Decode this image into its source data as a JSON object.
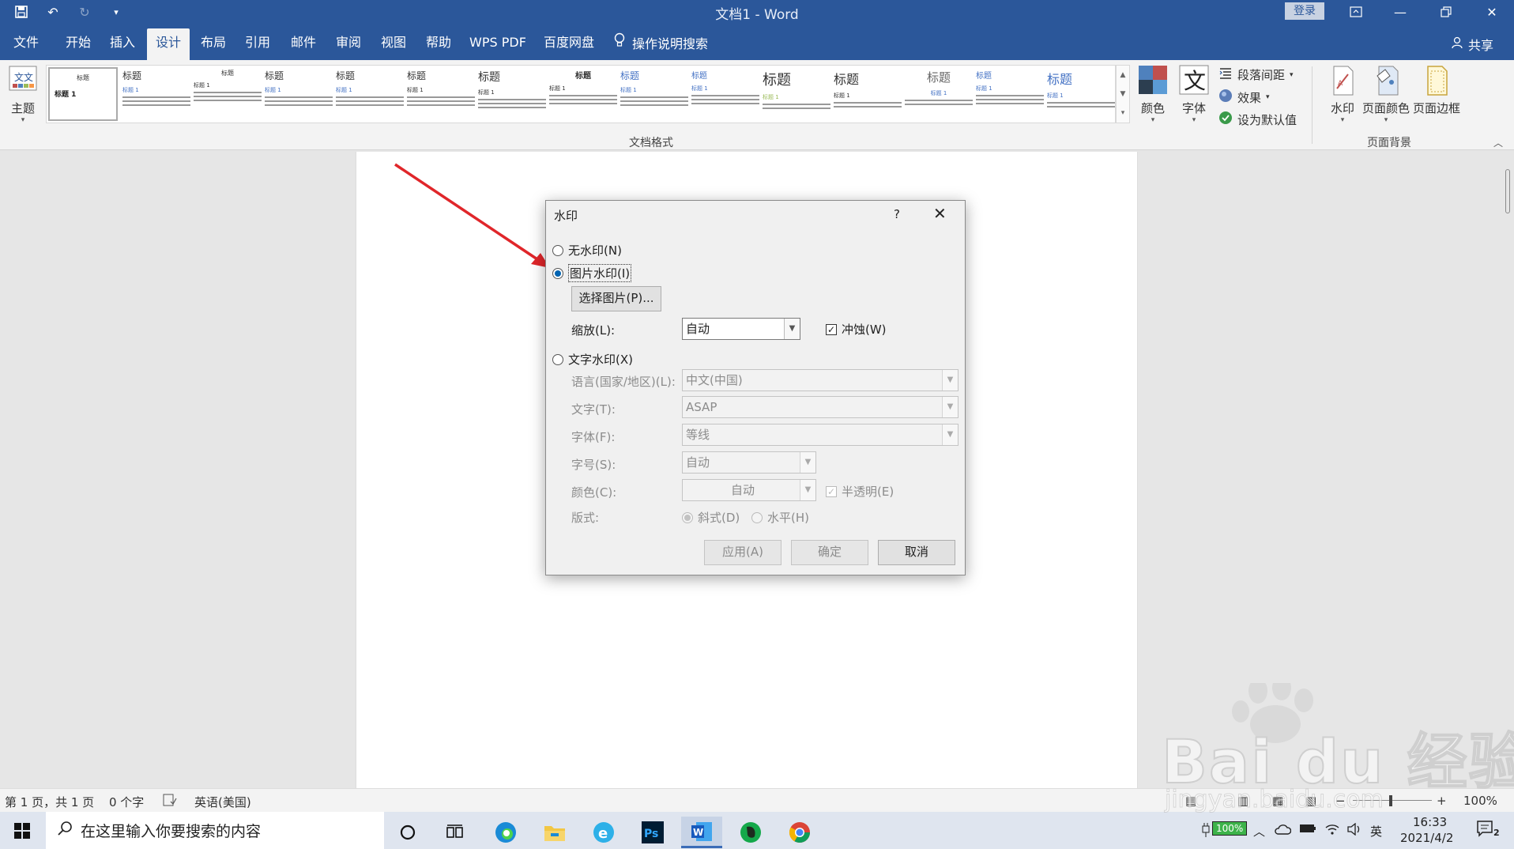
{
  "titlebar": {
    "title": "文档1  -  Word",
    "login": "登录"
  },
  "tabs": [
    {
      "label": "文件"
    },
    {
      "label": "开始"
    },
    {
      "label": "插入"
    },
    {
      "label": "设计"
    },
    {
      "label": "布局"
    },
    {
      "label": "引用"
    },
    {
      "label": "邮件"
    },
    {
      "label": "审阅"
    },
    {
      "label": "视图"
    },
    {
      "label": "帮助"
    },
    {
      "label": "WPS PDF"
    },
    {
      "label": "百度网盘"
    },
    {
      "label": "操作说明搜索"
    }
  ],
  "share": "共享",
  "ribbon": {
    "theme": "主题",
    "style_first_title": "标题",
    "style_first_sub": "标题 1",
    "style_title": "标题",
    "style_sub": "标题 1",
    "group_doc_format": "文档格式",
    "colors": "颜色",
    "fonts": "字体",
    "para_spacing": "段落间距",
    "effects": "效果",
    "set_default": "设为默认值",
    "watermark": "水印",
    "page_color": "页面颜色",
    "page_border": "页面边框",
    "group_page_bg": "页面背景"
  },
  "dialog": {
    "title": "水印",
    "help": "?",
    "no_wm": "无水印(N)",
    "pic_wm": "图片水印(I)",
    "choose_pic": "选择图片(P)...",
    "scale_label": "缩放(L):",
    "scale_value": "自动",
    "washout": "冲蚀(W)",
    "text_wm": "文字水印(X)",
    "lang_label": "语言(国家/地区)(L):",
    "lang_value": "中文(中国)",
    "text_label": "文字(T):",
    "text_value": "ASAP",
    "font_label": "字体(F):",
    "font_value": "等线",
    "size_label": "字号(S):",
    "size_value": "自动",
    "color_label": "颜色(C):",
    "color_value": "自动",
    "semi": "半透明(E)",
    "layout_label": "版式:",
    "diag": "斜式(D)",
    "horiz": "水平(H)",
    "apply": "应用(A)",
    "ok": "确定",
    "cancel": "取消"
  },
  "status": {
    "page": "第 1 页，共 1 页",
    "words": "0 个字",
    "lang": "英语(美国)",
    "zoom": "100%"
  },
  "taskbar": {
    "search_placeholder": "在这里输入你要搜索的内容",
    "battery": "100%",
    "ime": "英",
    "time": "16:33",
    "date": "2021/4/2",
    "notif_count": "2"
  },
  "watermark_logo": {
    "text": "Bai du 经验",
    "url_text": "jingyan.baidu.com"
  },
  "colors": {
    "accent": "#2b579a",
    "arrow": "#e0262a"
  }
}
